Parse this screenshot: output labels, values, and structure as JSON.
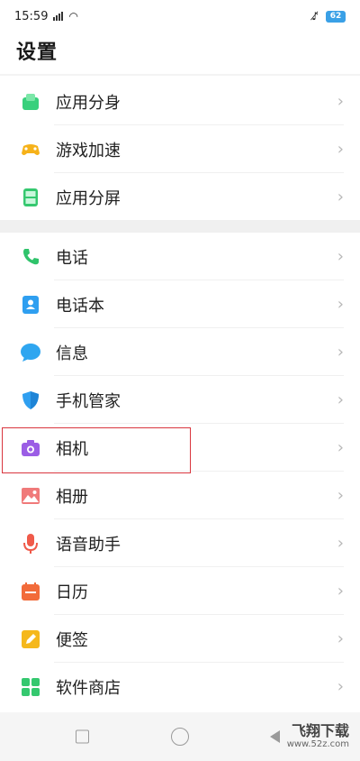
{
  "status": {
    "time": "15:59",
    "battery": "62"
  },
  "title": "设置",
  "group1": [
    {
      "id": "app-clone",
      "label": "应用分身",
      "icon": "app-clone-icon"
    },
    {
      "id": "game-accel",
      "label": "游戏加速",
      "icon": "gamepad-icon"
    },
    {
      "id": "split-screen",
      "label": "应用分屏",
      "icon": "split-screen-icon"
    }
  ],
  "group2": [
    {
      "id": "phone",
      "label": "电话",
      "icon": "phone-icon"
    },
    {
      "id": "contacts",
      "label": "电话本",
      "icon": "contacts-icon"
    },
    {
      "id": "messages",
      "label": "信息",
      "icon": "message-icon"
    },
    {
      "id": "phone-manager",
      "label": "手机管家",
      "icon": "shield-icon"
    },
    {
      "id": "camera",
      "label": "相机",
      "icon": "camera-icon"
    },
    {
      "id": "album",
      "label": "相册",
      "icon": "album-icon"
    },
    {
      "id": "voice-assistant",
      "label": "语音助手",
      "icon": "microphone-icon"
    },
    {
      "id": "calendar",
      "label": "日历",
      "icon": "calendar-icon"
    },
    {
      "id": "notes",
      "label": "便签",
      "icon": "note-icon"
    },
    {
      "id": "app-store",
      "label": "软件商店",
      "icon": "app-store-icon"
    }
  ],
  "watermark": {
    "title": "飞翔下载",
    "url": "www.52z.com"
  },
  "colors": {
    "highlight_border": "#d9363e",
    "section_gap": "#f0f0f0"
  }
}
